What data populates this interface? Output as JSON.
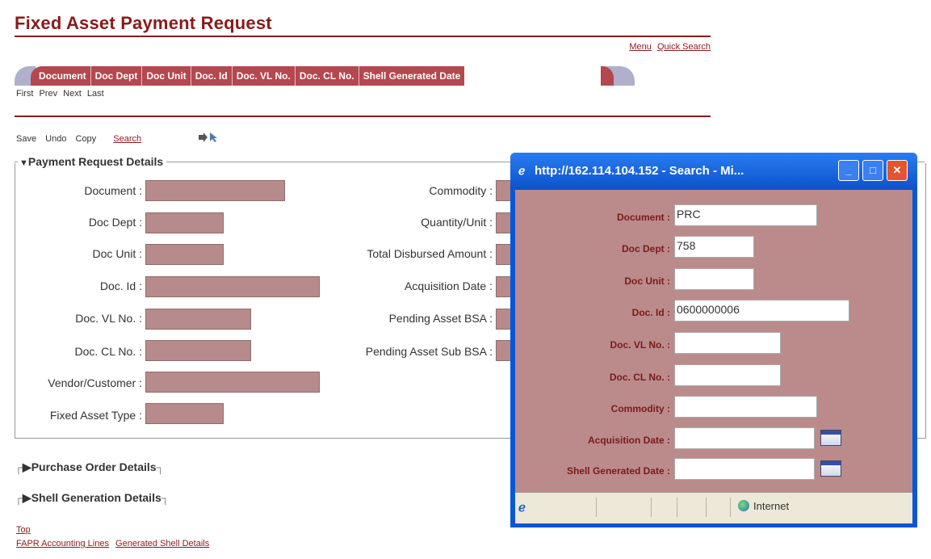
{
  "page": {
    "title": "Fixed Asset Payment Request",
    "top_links": [
      "Menu",
      "Quick Search"
    ]
  },
  "tabs": [
    "Document",
    "Doc Dept",
    "Doc Unit",
    "Doc. Id",
    "Doc. VL No.",
    "Doc. CL No.",
    "Shell Generated Date"
  ],
  "pager": [
    "First",
    "Prev",
    "Next",
    "Last"
  ],
  "actions": {
    "save": "Save",
    "undo": "Undo",
    "copy": "Copy",
    "search": "Search"
  },
  "details": {
    "legend": "Payment Request Details",
    "left_fields": [
      "Document :",
      "Doc Dept :",
      "Doc Unit :",
      "Doc. Id :",
      "Doc. VL No. :",
      "Doc. CL No. :",
      "Vendor/Customer :",
      "Fixed Asset Type :"
    ],
    "right_fields": [
      "Commodity :",
      "Quantity/Unit :",
      "Total Disbursed Amount :",
      "Acquisition Date :",
      "Pending Asset BSA :",
      "Pending Asset Sub BSA :"
    ]
  },
  "sections": [
    "Purchase Order Details",
    "Shell Generation Details"
  ],
  "bottom": {
    "top_link": "Top",
    "links": [
      "FAPR Accounting Lines",
      "Generated Shell Details"
    ]
  },
  "popup": {
    "title": "http://162.114.104.152 - Search - Mi...",
    "fields": [
      {
        "label": "Document :",
        "value": "PRC"
      },
      {
        "label": "Doc Dept :",
        "value": "758"
      },
      {
        "label": "Doc Unit :",
        "value": ""
      },
      {
        "label": "Doc. Id :",
        "value": "0600000006"
      },
      {
        "label": "Doc. VL No. :",
        "value": ""
      },
      {
        "label": "Doc. CL No. :",
        "value": ""
      },
      {
        "label": "Commodity :",
        "value": ""
      },
      {
        "label": "Acquisition Date :",
        "value": ""
      },
      {
        "label": "Shell Generated Date :",
        "value": ""
      }
    ],
    "status_zone": "Internet"
  },
  "colors": {
    "brand": "#8b1a1a",
    "tab_bg": "#b5474f",
    "field_bg": "#b78b8b",
    "popup_bg": "#bb8b8b",
    "xp_blue": "#0a57d6"
  }
}
